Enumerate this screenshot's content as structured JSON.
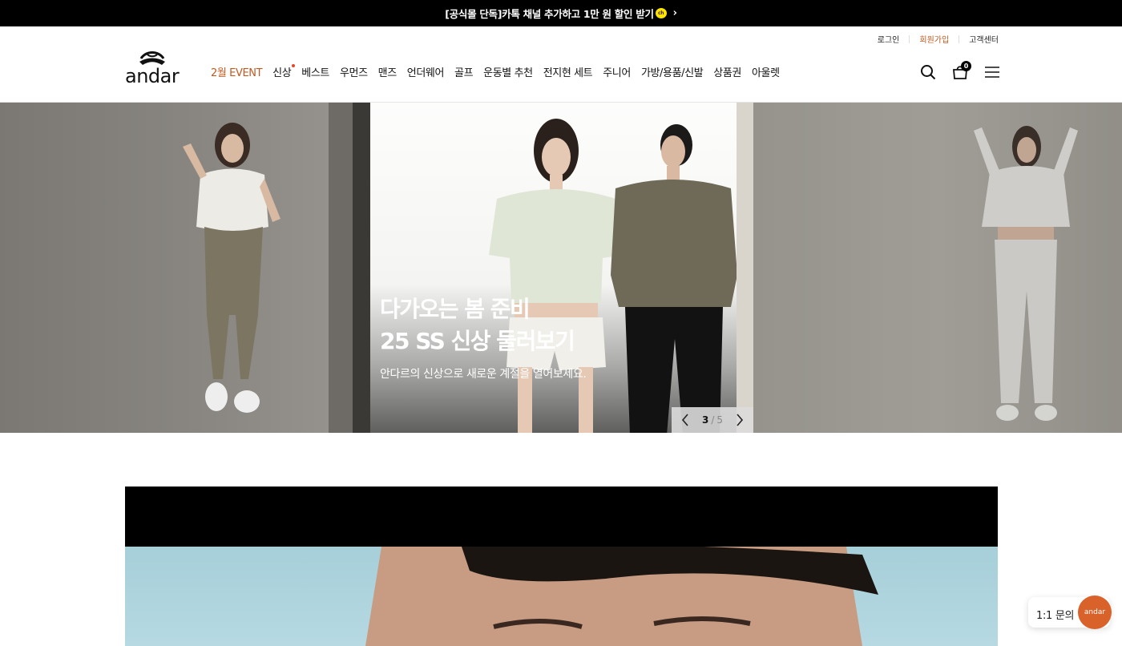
{
  "topbar": {
    "text": "[공식몰 단독]카톡 채널 추가하고 1만 원 할인 받기",
    "kakao_badge": "ch"
  },
  "util_nav": {
    "login": "로그인",
    "signup": "회원가입",
    "support": "고객센터"
  },
  "logo": {
    "text": "andar"
  },
  "gnb": [
    "2월 EVENT",
    "신상",
    "베스트",
    "우먼즈",
    "맨즈",
    "언더웨어",
    "골프",
    "운동별 추천",
    "전지현 세트",
    "주니어",
    "가방/용품/신발",
    "상품권",
    "아울렛"
  ],
  "header_icons": {
    "search": "search-icon",
    "cart": "cart-icon",
    "menu": "menu-icon",
    "cart_count": "0"
  },
  "hero": {
    "title_line1": "다가오는 봄 준비",
    "title_line2": "25 SS 신상 둘러보기",
    "subtitle": "안다르의 신상으로 새로운 계절을 열어보세요.",
    "pager": {
      "current": "3",
      "separator": "/",
      "total": "5"
    }
  },
  "chat_widget": {
    "label": "1:1 문의",
    "bubble": "andar"
  },
  "colors": {
    "accent": "#c2591e",
    "topbar_bg": "#000000",
    "chat_bubble": "#d9622b"
  }
}
